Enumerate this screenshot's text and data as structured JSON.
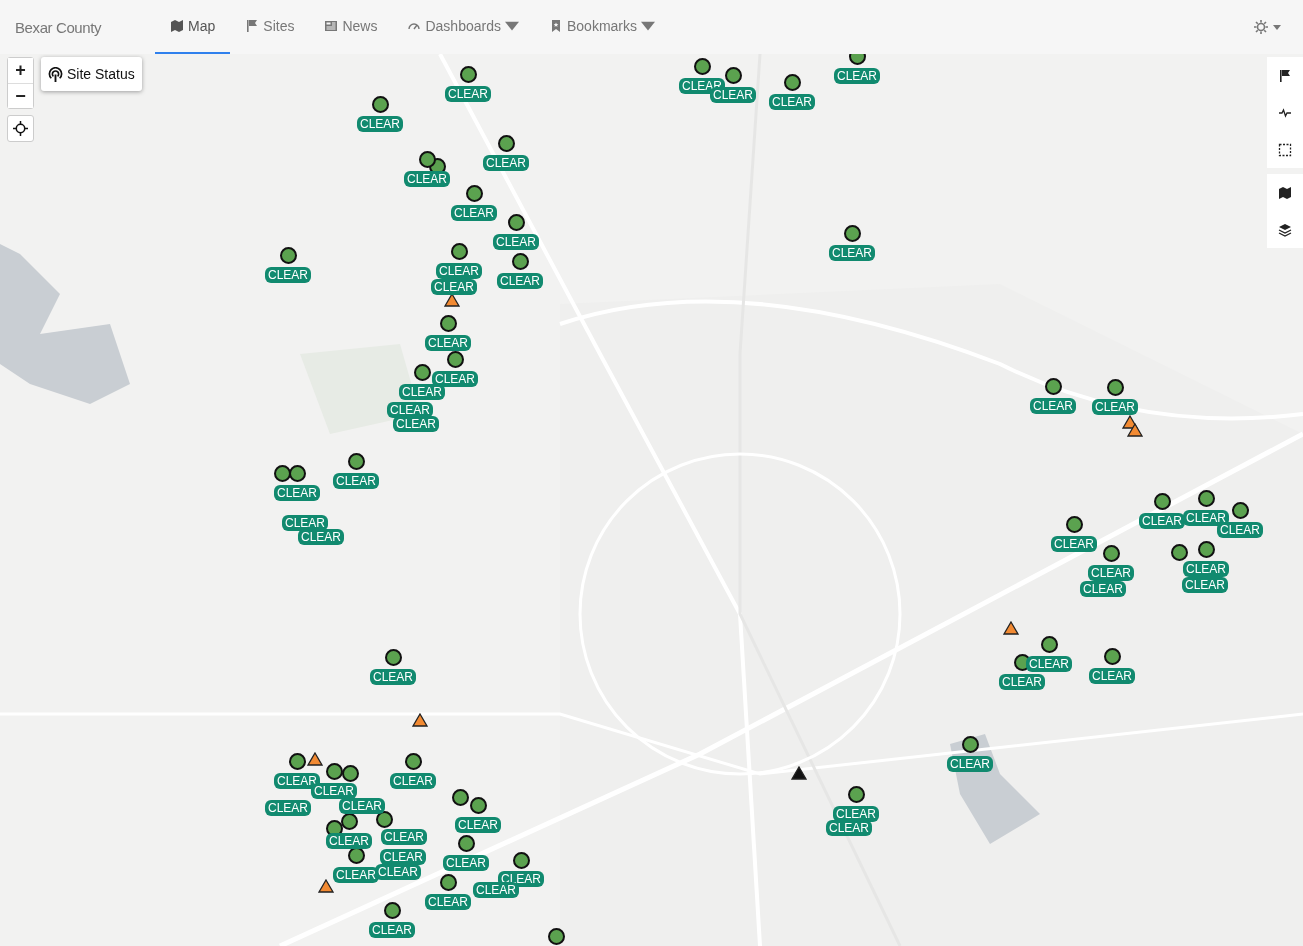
{
  "navbar": {
    "brand": "Bexar County",
    "tabs": [
      {
        "label": "Map",
        "selected": true,
        "dropdown": false
      },
      {
        "label": "Sites",
        "selected": false,
        "dropdown": false
      },
      {
        "label": "News",
        "selected": false,
        "dropdown": false
      },
      {
        "label": "Dashboards",
        "selected": false,
        "dropdown": true
      },
      {
        "label": "Bookmarks",
        "selected": false,
        "dropdown": true
      }
    ]
  },
  "map": {
    "zoom_in": "+",
    "zoom_out": "−",
    "layer_button": "Site Status",
    "markers": [
      {
        "kind": "site",
        "color": "#5ba24f",
        "label": "CLEAR"
      },
      {
        "kind": "site",
        "color": "#5ba24f",
        "label": "CLEAR"
      },
      {
        "kind": "site",
        "color": "#5ba24f",
        "label": "CLEAR"
      },
      {
        "kind": "site",
        "color": "#5ba24f",
        "label": "CLEAR"
      },
      {
        "kind": "site",
        "color": "#5ba24f",
        "label": "CLEAR"
      },
      {
        "kind": "site",
        "color": "#5ba24f",
        "label": "CLEAR"
      },
      {
        "kind": "site",
        "color": "#5ba24f",
        "label": "CLEAR"
      },
      {
        "kind": "site",
        "color": "#5ba24f",
        "label": "CLEAR"
      },
      {
        "kind": "site",
        "color": "#5ba24f",
        "label": "CLEAR"
      },
      {
        "kind": "site",
        "color": "#5ba24f"
      },
      {
        "kind": "site",
        "color": "#5ba24f",
        "label": "CLEAR"
      },
      {
        "kind": "site",
        "color": "#5ba24f",
        "label": "CLEAR"
      },
      {
        "kind": "site",
        "color": "#5ba24f",
        "label": "CLEAR"
      },
      {
        "kind": "site",
        "color": "#5ba24f",
        "label": "CLEAR"
      },
      {
        "kind": "site",
        "color": "#5ba24f",
        "label": "CLEAR"
      },
      {
        "kind": "tag",
        "label": "CLEAR"
      },
      {
        "kind": "alert",
        "color": "#f28a32"
      },
      {
        "kind": "site",
        "color": "#5ba24f",
        "label": "CLEAR"
      },
      {
        "kind": "site",
        "color": "#5ba24f",
        "label": "CLEAR"
      },
      {
        "kind": "site",
        "color": "#5ba24f",
        "label": "CLEAR"
      },
      {
        "kind": "tag",
        "label": "CLEAR"
      },
      {
        "kind": "tag",
        "label": "CLEAR"
      },
      {
        "kind": "site",
        "color": "#5ba24f",
        "label": "CLEAR"
      },
      {
        "kind": "site",
        "color": "#5ba24f"
      },
      {
        "kind": "site",
        "color": "#5ba24f",
        "label": "CLEAR"
      },
      {
        "kind": "tag",
        "label": "CLEAR"
      },
      {
        "kind": "tag",
        "label": "CLEAR"
      },
      {
        "kind": "site",
        "color": "#5ba24f",
        "label": "CLEAR"
      },
      {
        "kind": "site",
        "color": "#5ba24f",
        "label": "CLEAR"
      },
      {
        "kind": "alert",
        "color": "#f28a32"
      },
      {
        "kind": "alert",
        "color": "#f28a32"
      },
      {
        "kind": "site",
        "color": "#5ba24f",
        "label": "CLEAR"
      },
      {
        "kind": "site",
        "color": "#5ba24f",
        "label": "CLEAR"
      },
      {
        "kind": "site",
        "color": "#5ba24f",
        "label": "CLEAR"
      },
      {
        "kind": "site",
        "color": "#5ba24f",
        "label": "CLEAR"
      },
      {
        "kind": "site",
        "color": "#5ba24f",
        "label": "CLEAR"
      },
      {
        "kind": "tag",
        "label": "CLEAR"
      },
      {
        "kind": "site",
        "color": "#5ba24f"
      },
      {
        "kind": "site",
        "color": "#5ba24f",
        "label": "CLEAR"
      },
      {
        "kind": "tag",
        "label": "CLEAR"
      },
      {
        "kind": "alert",
        "color": "#f28a32"
      },
      {
        "kind": "site",
        "color": "#5ba24f",
        "label": "CLEAR"
      },
      {
        "kind": "site",
        "color": "#5ba24f",
        "label": "CLEAR"
      },
      {
        "kind": "site",
        "color": "#5ba24f",
        "label": "CLEAR"
      },
      {
        "kind": "site",
        "color": "#5ba24f",
        "label": "CLEAR"
      },
      {
        "kind": "alert",
        "color": "#f28a32"
      },
      {
        "kind": "site",
        "color": "#5ba24f",
        "label": "CLEAR"
      },
      {
        "kind": "alert",
        "color": "#111111"
      },
      {
        "kind": "site",
        "color": "#5ba24f",
        "label": "CLEAR"
      },
      {
        "kind": "tag",
        "label": "CLEAR"
      },
      {
        "kind": "alert",
        "color": "#f28a32"
      },
      {
        "kind": "site",
        "color": "#5ba24f",
        "label": "CLEAR"
      },
      {
        "kind": "tag",
        "label": "CLEAR"
      },
      {
        "kind": "site",
        "color": "#5ba24f",
        "label": "CLEAR"
      },
      {
        "kind": "site",
        "color": "#5ba24f"
      },
      {
        "kind": "tag",
        "label": "CLEAR"
      },
      {
        "kind": "site",
        "color": "#5ba24f",
        "label": "CLEAR"
      },
      {
        "kind": "site",
        "color": "#5ba24f"
      },
      {
        "kind": "site",
        "color": "#5ba24f",
        "label": "CLEAR"
      },
      {
        "kind": "site",
        "color": "#5ba24f",
        "label": "CLEAR"
      },
      {
        "kind": "site",
        "color": "#5ba24f",
        "label": "CLEAR"
      },
      {
        "kind": "site",
        "color": "#5ba24f"
      },
      {
        "kind": "site",
        "color": "#5ba24f",
        "label": "CLEAR"
      },
      {
        "kind": "site",
        "color": "#5ba24f",
        "label": "CLEAR"
      },
      {
        "kind": "tag",
        "label": "CLEAR"
      },
      {
        "kind": "tag",
        "label": "CLEAR"
      },
      {
        "kind": "site",
        "color": "#5ba24f",
        "label": "CLEAR"
      },
      {
        "kind": "tag",
        "label": "CLEAR"
      },
      {
        "kind": "site",
        "color": "#5ba24f",
        "label": "CLEAR"
      },
      {
        "kind": "alert",
        "color": "#f28a32"
      },
      {
        "kind": "site",
        "color": "#5ba24f",
        "label": "CLEAR"
      },
      {
        "kind": "site",
        "color": "#5ba24f"
      }
    ]
  }
}
